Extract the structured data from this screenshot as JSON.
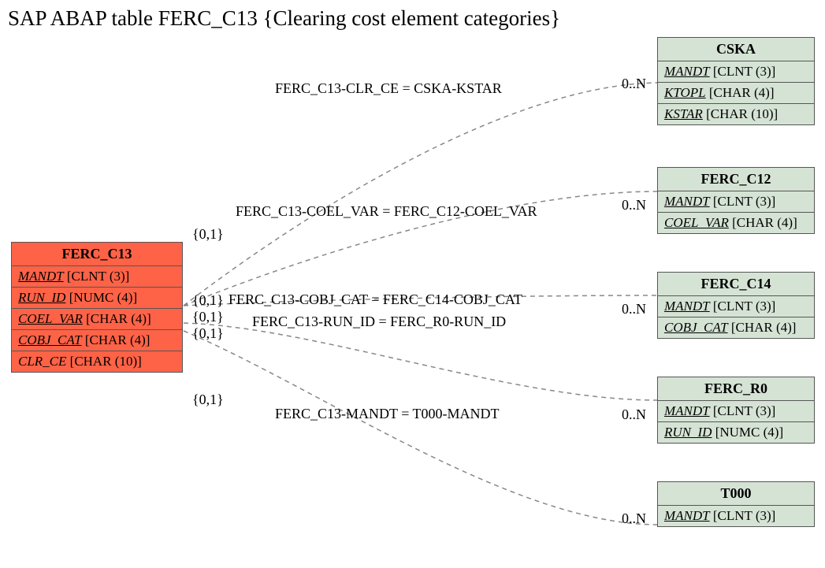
{
  "title": "SAP ABAP table FERC_C13 {Clearing cost element categories}",
  "source": {
    "name": "FERC_C13",
    "fields": [
      {
        "name": "MANDT",
        "type": "[CLNT (3)]",
        "key": true
      },
      {
        "name": "RUN_ID",
        "type": "[NUMC (4)]",
        "key": true
      },
      {
        "name": "COEL_VAR",
        "type": "[CHAR (4)]",
        "key": true
      },
      {
        "name": "COBJ_CAT",
        "type": "[CHAR (4)]",
        "key": true
      },
      {
        "name": "CLR_CE",
        "type": "[CHAR (10)]",
        "key": false
      }
    ]
  },
  "targets": [
    {
      "name": "CSKA",
      "fields": [
        {
          "name": "MANDT",
          "type": "[CLNT (3)]",
          "key": true
        },
        {
          "name": "KTOPL",
          "type": "[CHAR (4)]",
          "key": true
        },
        {
          "name": "KSTAR",
          "type": "[CHAR (10)]",
          "key": true
        }
      ]
    },
    {
      "name": "FERC_C12",
      "fields": [
        {
          "name": "MANDT",
          "type": "[CLNT (3)]",
          "key": true
        },
        {
          "name": "COEL_VAR",
          "type": "[CHAR (4)]",
          "key": true
        }
      ]
    },
    {
      "name": "FERC_C14",
      "fields": [
        {
          "name": "MANDT",
          "type": "[CLNT (3)]",
          "key": true
        },
        {
          "name": "COBJ_CAT",
          "type": "[CHAR (4)]",
          "key": true
        }
      ]
    },
    {
      "name": "FERC_R0",
      "fields": [
        {
          "name": "MANDT",
          "type": "[CLNT (3)]",
          "key": true
        },
        {
          "name": "RUN_ID",
          "type": "[NUMC (4)]",
          "key": true
        }
      ]
    },
    {
      "name": "T000",
      "fields": [
        {
          "name": "MANDT",
          "type": "[CLNT (3)]",
          "key": true
        }
      ]
    }
  ],
  "relations": [
    {
      "label": "FERC_C13-CLR_CE = CSKA-KSTAR",
      "left_card": "",
      "right_card": "0..N"
    },
    {
      "label": "FERC_C13-COEL_VAR = FERC_C12-COEL_VAR",
      "left_card": "{0,1}",
      "right_card": "0..N"
    },
    {
      "label": "FERC_C13-COBJ_CAT = FERC_C14-COBJ_CAT",
      "left_card": "{0,1}",
      "right_card": "0..N"
    },
    {
      "label": "FERC_C13-RUN_ID = FERC_R0-RUN_ID",
      "left_card": "{0,1}",
      "right_card": ""
    },
    {
      "label": "FERC_C13-MANDT = T000-MANDT",
      "left_card": "{0,1}",
      "right_card": "0..N"
    },
    {
      "label": "",
      "left_card": "{0,1}",
      "right_card": "0..N"
    }
  ]
}
